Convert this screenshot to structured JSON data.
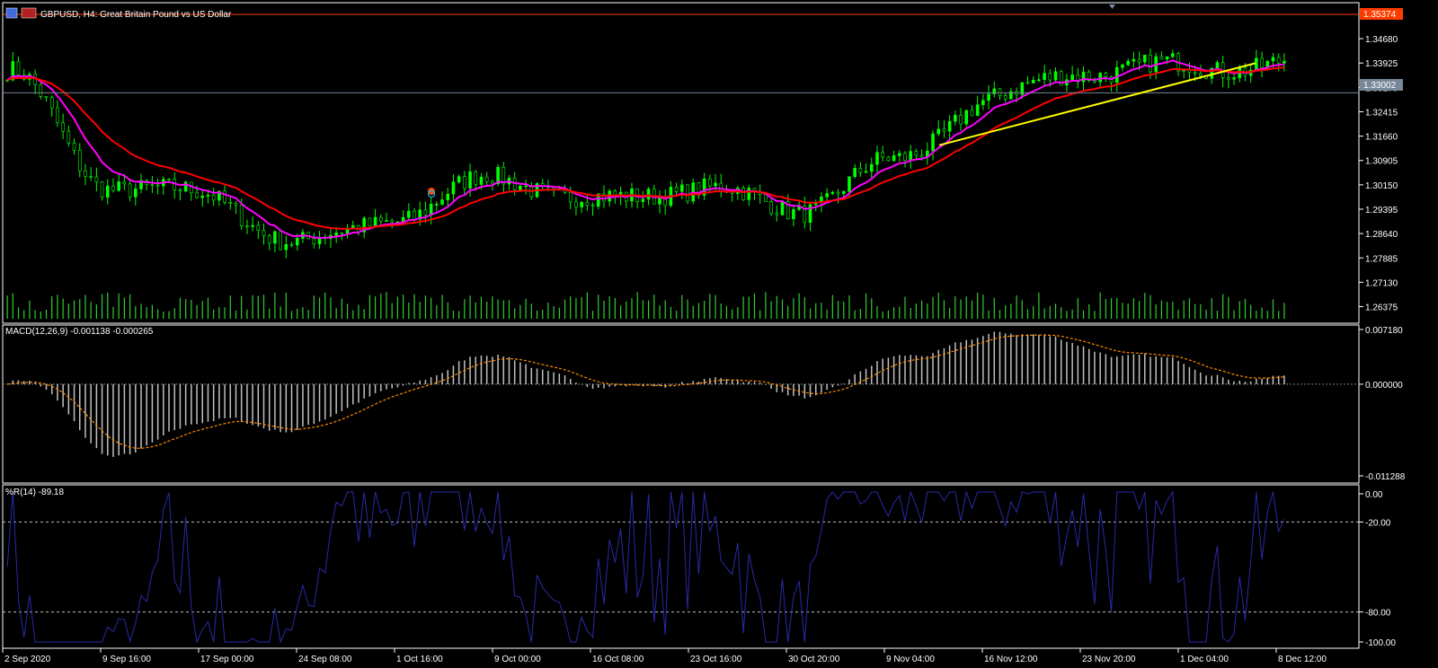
{
  "window": {
    "title": "GBPUSD, H4:  Great Britain Pound vs US Dollar",
    "symbol": "GBPUSD",
    "timeframe": "H4"
  },
  "colors": {
    "background": "#000000",
    "frame": "#ffffff",
    "candle": "#00ff00",
    "volume": "#32cd32",
    "ma_fast": "#ff00ff",
    "ma_slow": "#ff0000",
    "trendline": "#ffff00",
    "high_line": "#ff3c00",
    "bid_line": "#778899",
    "macd_hist": "#c0c0c0",
    "macd_signal": "#ff8c00",
    "wpr_line": "#000080",
    "wpr_levels": "#c0c0c0"
  },
  "price_panel": {
    "current_high_label": "1.35374",
    "current_bid_label": "1.33002",
    "price_ticks": [
      "1.34680",
      "1.33925",
      "1.33170",
      "1.32415",
      "1.31660",
      "1.30905",
      "1.30150",
      "1.29395",
      "1.28640",
      "1.27885",
      "1.27130",
      "1.26375"
    ]
  },
  "macd_panel": {
    "label": "MACD(12,26,9) -0.001138 -0.000265",
    "ticks": [
      "0.007180",
      "0.000000",
      "-0.011288"
    ]
  },
  "wpr_panel": {
    "label": "%R(14) -89.18",
    "ticks": [
      "0.00",
      "-20.00",
      "-80.00",
      "-100.00"
    ]
  },
  "time_axis": [
    "2 Sep 2020",
    "9 Sep 16:00",
    "17 Sep 00:00",
    "24 Sep 08:00",
    "1 Oct 16:00",
    "9 Oct 00:00",
    "16 Oct 08:00",
    "23 Oct 16:00",
    "30 Oct 20:00",
    "9 Nov 04:00",
    "16 Nov 12:00",
    "23 Nov 20:00",
    "1 Dec 04:00",
    "8 Dec 12:00"
  ],
  "chart_data": {
    "type": "line",
    "title": "GBPUSD, H4:  Great Britain Pound vs US Dollar",
    "x_ticks": [
      "2 Sep 2020",
      "9 Sep 16:00",
      "17 Sep 00:00",
      "24 Sep 08:00",
      "1 Oct 16:00",
      "9 Oct 00:00",
      "16 Oct 08:00",
      "23 Oct 16:00",
      "30 Oct 20:00",
      "9 Nov 04:00",
      "16 Nov 12:00",
      "23 Nov 20:00",
      "1 Dec 04:00",
      "8 Dec 12:00"
    ],
    "price_ylim": [
      1.26,
      1.356
    ],
    "macd_ylim": [
      -0.011288,
      0.00718
    ],
    "wpr_ylim": [
      -100,
      0
    ],
    "price_close_at_ticks": [
      1.337,
      1.302,
      1.298,
      1.283,
      1.292,
      1.304,
      1.296,
      1.301,
      1.294,
      1.308,
      1.328,
      1.337,
      1.338,
      1.339
    ],
    "trendline": {
      "from": [
        1.3138
      ],
      "to": [
        1.3392
      ]
    },
    "grid": false,
    "legend": "none"
  }
}
